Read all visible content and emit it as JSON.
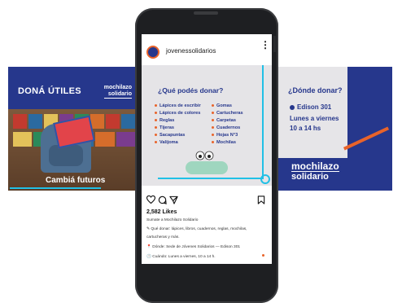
{
  "left_slide": {
    "title": "DONÁ ÚTILES",
    "logo_line1": "mochilazo",
    "logo_line2": "solidario",
    "caption": "Cambiá futuros"
  },
  "right_slide": {
    "question": "¿Dónde donar?",
    "address": "Edison 301",
    "days": "Lunes a viernes",
    "hours": "10 a 14 hs",
    "logo_line1": "mochilazo",
    "logo_line2": "solidario"
  },
  "post_header": {
    "username": "jovenessolidarios",
    "more_icon": "more-vertical-icon"
  },
  "post_image": {
    "question": "¿Qué podés donar?",
    "items_left": [
      "Lápices de escribir",
      "Lápices de colores",
      "Reglas",
      "Tijeras",
      "Sacapuntas",
      "Valijoma"
    ],
    "items_right": [
      "Gomas",
      "Cartucheras",
      "Carpetas",
      "Cuadernos",
      "Hojas N°3",
      "Mochilas"
    ],
    "accent_color": "#e8632a",
    "primary_color": "#26378c"
  },
  "actions": {
    "heart_icon": "heart-icon",
    "comment_icon": "comment-icon",
    "share_icon": "share-icon",
    "save_icon": "bookmark-icon"
  },
  "likes": "2,582 Likes",
  "caption_lines": [
    "Sumate a Mochilazo Solidario",
    "✎ Qué donar: lápices, libros, cuadernos, reglas, mochilas,",
    "cartucheras y más.",
    "📍 Dónde: Sede de Jóvenes Solidarios — Edison 301",
    "🕑 Cuándo: Lunes a viernes, 10 a 14 h."
  ]
}
